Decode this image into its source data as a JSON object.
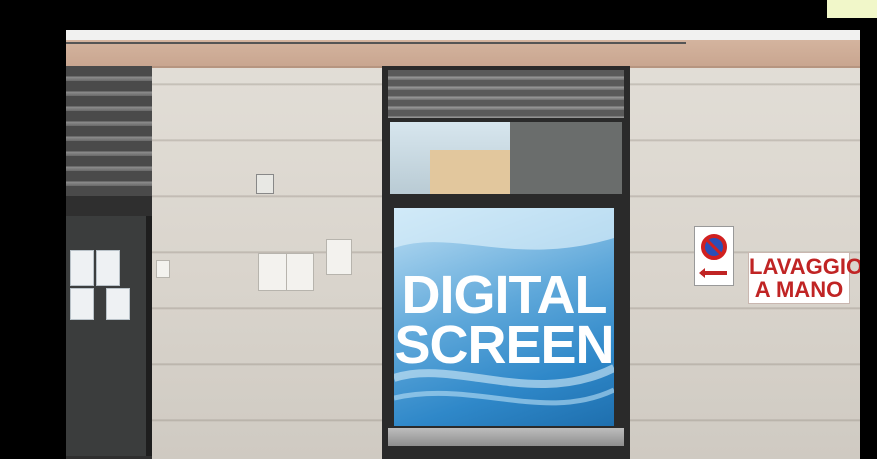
{
  "screen": {
    "title": "DIGITAL\nSCREEN"
  },
  "shop_sign": {
    "text": "LAVAGGIO\nA MANO"
  },
  "colors": {
    "screen_blue": "#2f88c9",
    "sign_red": "#c02424",
    "wall": "#ddd8d0",
    "frame": "#2a2a2a"
  }
}
